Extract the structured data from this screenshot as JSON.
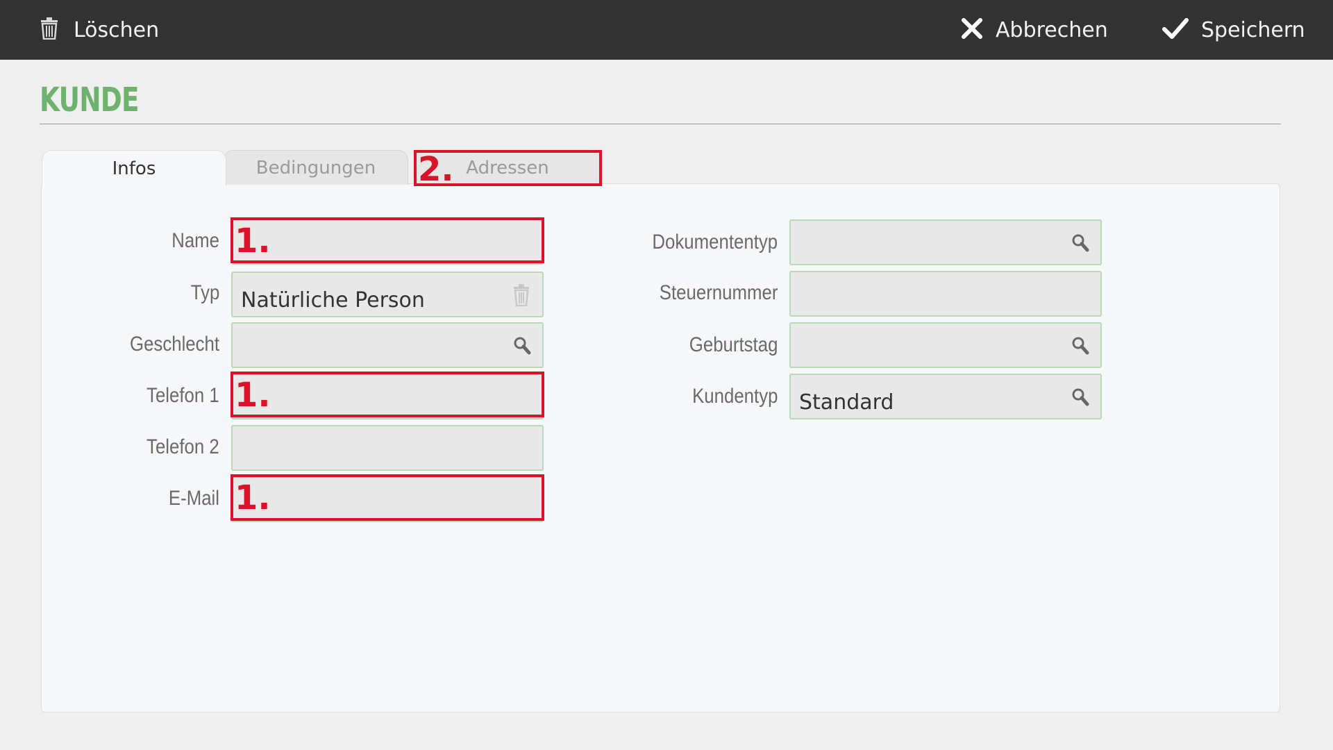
{
  "toolbar": {
    "delete_label": "Löschen",
    "cancel_label": "Abbrechen",
    "save_label": "Speichern",
    "delete_icon": "trash-icon",
    "cancel_icon": "close-icon",
    "save_icon": "checkmark-icon"
  },
  "page": {
    "title": "KUNDE",
    "accent_color": "#6db36d",
    "annotation_color": "#d9132a"
  },
  "tabs": [
    {
      "label": "Infos",
      "active": true
    },
    {
      "label": "Bedingungen",
      "active": false
    },
    {
      "label": "Adressen",
      "active": false
    }
  ],
  "form": {
    "left": [
      {
        "label": "Name",
        "value": ""
      },
      {
        "label": "Typ",
        "value": "Natürliche Person",
        "icon": "trash-icon"
      },
      {
        "label": "Geschlecht",
        "value": "",
        "icon": "search-icon"
      },
      {
        "label": "Telefon 1",
        "value": ""
      },
      {
        "label": "Telefon 2",
        "value": ""
      },
      {
        "label": "E-Mail",
        "value": ""
      }
    ],
    "right": [
      {
        "label": "Dokumententyp",
        "value": "",
        "icon": "search-icon"
      },
      {
        "label": "Steuernummer",
        "value": ""
      },
      {
        "label": "Geburtstag",
        "value": "",
        "icon": "search-icon"
      },
      {
        "label": "Kundentyp",
        "value": "Standard",
        "icon": "search-icon"
      }
    ]
  },
  "annotations": {
    "step1": "1.",
    "step2": "2."
  }
}
